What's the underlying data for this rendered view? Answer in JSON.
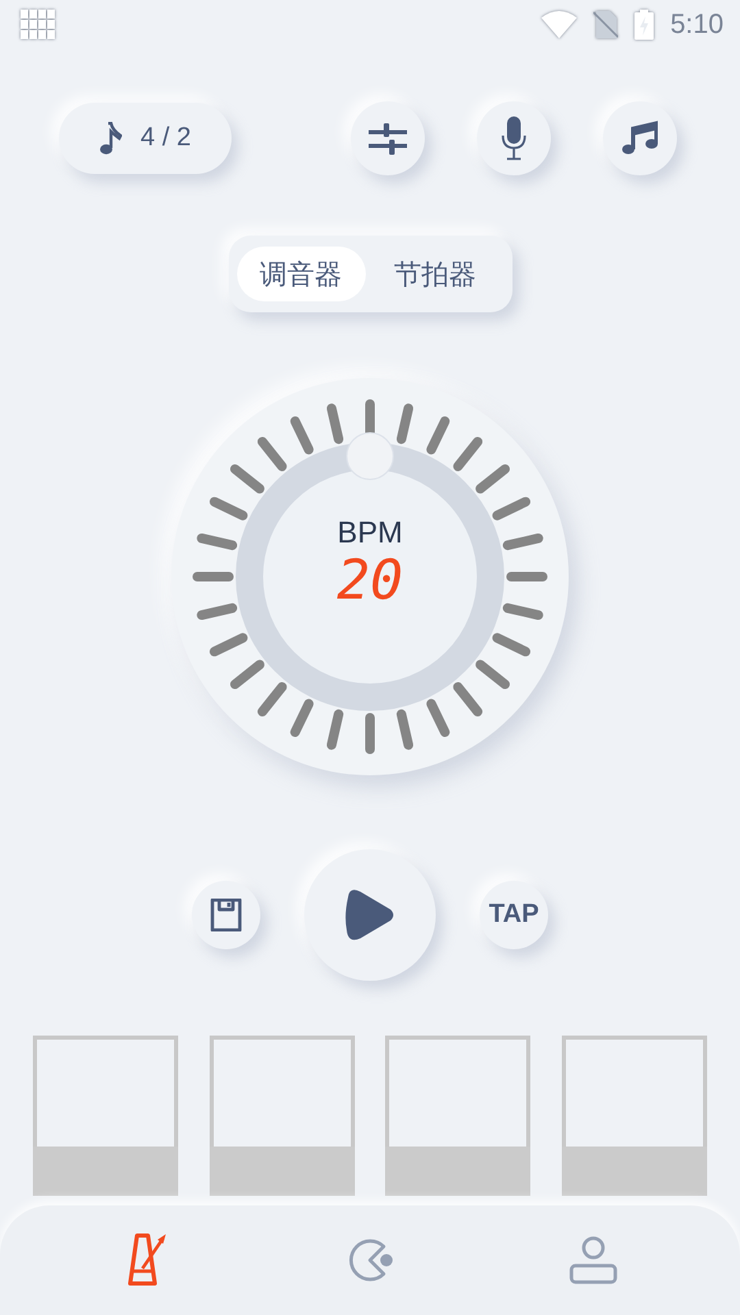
{
  "status_bar": {
    "time": "5:10"
  },
  "time_signature": {
    "text": "4 / 2"
  },
  "toolbar": [
    {
      "kind": "sliders"
    },
    {
      "kind": "mic"
    },
    {
      "kind": "music"
    }
  ],
  "mode_tabs": [
    {
      "label": "调音器",
      "selected": true
    },
    {
      "label": "节拍器",
      "selected": false
    }
  ],
  "dial": {
    "label": "BPM",
    "value": "20"
  },
  "tap_button": {
    "label": "TAP"
  },
  "beats": [
    {
      "active": false
    },
    {
      "active": false
    },
    {
      "active": false
    },
    {
      "active": false
    }
  ],
  "nav": [
    {
      "kind": "metronome",
      "selected": true
    },
    {
      "kind": "pacman",
      "selected": false
    },
    {
      "kind": "profile",
      "selected": false
    }
  ]
}
